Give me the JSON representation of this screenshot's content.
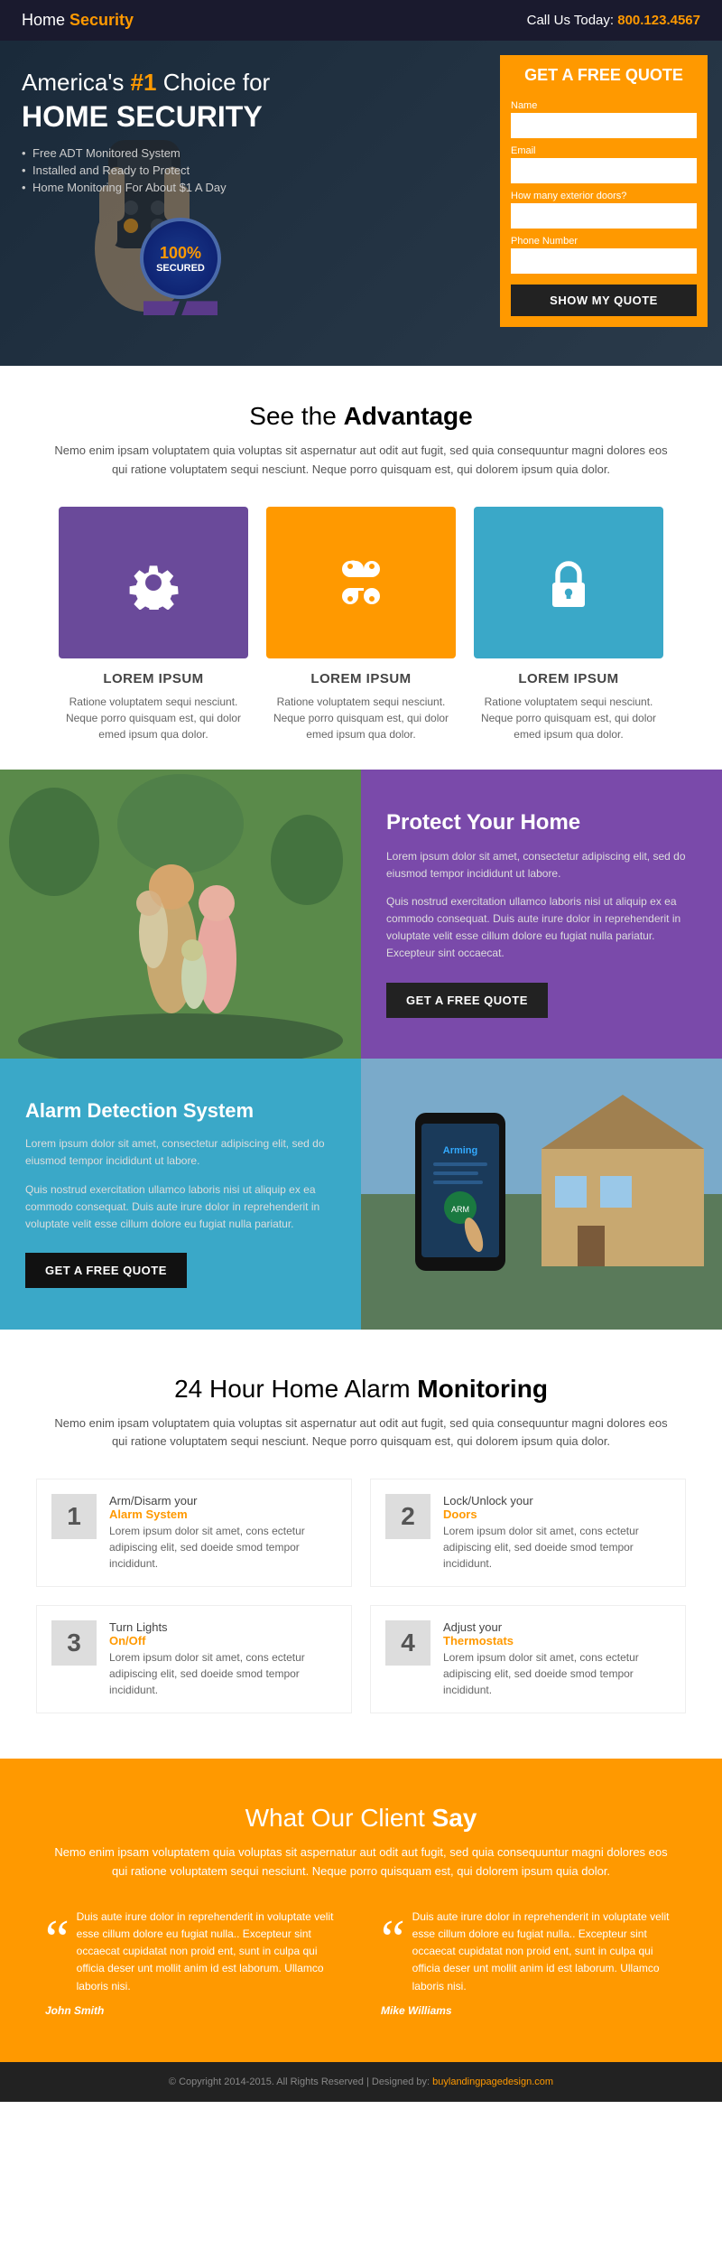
{
  "header": {
    "logo_prefix": "Home ",
    "logo_bold": "Security",
    "phone_prefix": "Call Us Today: ",
    "phone_number": "800.123.4567"
  },
  "hero": {
    "headline_part1": "America's ",
    "headline_num": "#1",
    "headline_part2": " Choice for",
    "headline_big": "HOME SECURITY",
    "bullets": [
      "Free ADT Monitored System",
      "Installed and Ready to Protect",
      "Home Monitoring For About $1 A Day"
    ],
    "badge_pct": "100%",
    "badge_label": "SECURED"
  },
  "quote_form": {
    "title_line1": "GET A FREE QUOTE",
    "label_name": "Name",
    "label_email": "Email",
    "label_doors": "How many exterior doors?",
    "label_phone": "Phone Number",
    "btn_label": "SHOW MY QUOTE"
  },
  "advantage": {
    "section_title_prefix": "See the ",
    "section_title_bold": "Advantage",
    "desc": "Nemo enim ipsam voluptatem quia voluptas sit aspernatur aut odit aut fugit, sed quia consequuntur magni dolores eos qui ratione voluptatem sequi nesciunt. Neque porro quisquam est, qui dolorem ipsum quia dolor.",
    "cards": [
      {
        "icon": "gear",
        "title": "LOREM IPSUM",
        "desc": "Ratione voluptatem sequi nesciunt. Neque porro quisquam est, qui dolor emed ipsum qua dolor.",
        "color": "purple"
      },
      {
        "icon": "command",
        "title": "LOREM IPSUM",
        "desc": "Ratione voluptatem sequi nesciunt. Neque porro quisquam est, qui dolor emed ipsum qua dolor.",
        "color": "orange"
      },
      {
        "icon": "lock",
        "title": "LOREM IPSUM",
        "desc": "Ratione voluptatem sequi nesciunt. Neque porro quisquam est, qui dolor emed ipsum qua dolor.",
        "color": "teal"
      }
    ]
  },
  "protect": {
    "title": "Protect Your Home",
    "body1": "Lorem ipsum dolor sit amet, consectetur adipiscing elit, sed do eiusmod tempor incididunt ut labore.",
    "body2": "Quis nostrud exercitation ullamco laboris nisi ut aliquip ex ea commodo consequat. Duis aute irure dolor in reprehenderit in voluptate velit esse cillum dolore eu fugiat nulla pariatur. Excepteur sint occaecat.",
    "btn_label": "GET A FREE QUOTE"
  },
  "alarm": {
    "title": "Alarm Detection System",
    "body1": "Lorem ipsum dolor sit amet, consectetur adipiscing elit, sed do eiusmod tempor incididunt ut labore.",
    "body2": "Quis nostrud exercitation ullamco laboris nisi ut aliquip ex ea commodo consequat. Duis aute irure dolor in reprehenderit in voluptate velit esse cillum dolore eu fugiat nulla pariatur.",
    "btn_label": "GET A FREE QUOTE"
  },
  "monitoring": {
    "title_prefix": "24 Hour Home Alarm ",
    "title_bold": "Monitoring",
    "desc": "Nemo enim ipsam voluptatem quia voluptas sit aspernatur aut odit aut fugit, sed quia consequuntur magni dolores eos qui ratione voluptatem sequi nesciunt. Neque porro quisquam est, qui dolorem ipsum quia dolor.",
    "items": [
      {
        "number": "1",
        "title_plain": "Arm/Disarm your",
        "title_orange": "Alarm System",
        "desc": "Lorem ipsum dolor sit amet, cons ectetur adipiscing elit, sed doeide smod tempor incididunt."
      },
      {
        "number": "2",
        "title_plain": "Lock/Unlock your",
        "title_orange": "Doors",
        "desc": "Lorem ipsum dolor sit amet, cons ectetur adipiscing elit, sed doeide smod tempor incididunt."
      },
      {
        "number": "3",
        "title_plain": "Turn Lights",
        "title_orange": "On/Off",
        "desc": "Lorem ipsum dolor sit amet, cons ectetur adipiscing elit, sed doeide smod tempor incididunt."
      },
      {
        "number": "4",
        "title_plain": "Adjust your",
        "title_orange": "Thermostats",
        "desc": "Lorem ipsum dolor sit amet, cons ectetur adipiscing elit, sed doeide smod tempor incididunt."
      }
    ]
  },
  "testimonials": {
    "title_prefix": "What Our Client ",
    "title_bold": "Say",
    "desc": "Nemo enim ipsam voluptatem quia voluptas sit aspernatur aut odit aut fugit, sed quia consequuntur magni dolores eos qui ratione voluptatem sequi nesciunt. Neque porro quisquam est, qui dolorem ipsum quia dolor.",
    "items": [
      {
        "text": "Duis aute irure dolor in reprehenderit in voluptate velit esse cillum dolore eu fugiat nulla.. Excepteur sint occaecat cupidatat non proid ent, sunt in culpa qui officia deser unt mollit anim id est laborum. Ullamco laboris nisi.",
        "name": "John Smith"
      },
      {
        "text": "Duis aute irure dolor in reprehenderit in voluptate velit esse cillum dolore eu fugiat nulla.. Excepteur sint occaecat cupidatat non proid ent, sunt in culpa qui officia deser unt mollit anim id est laborum. Ullamco laboris nisi.",
        "name": "Mike Williams"
      }
    ]
  },
  "footer": {
    "text": "© Copyright 2014-2015. All Rights Reserved  |  Designed by: ",
    "link_text": "buylandingpagedesign.com",
    "link_url": "#"
  }
}
